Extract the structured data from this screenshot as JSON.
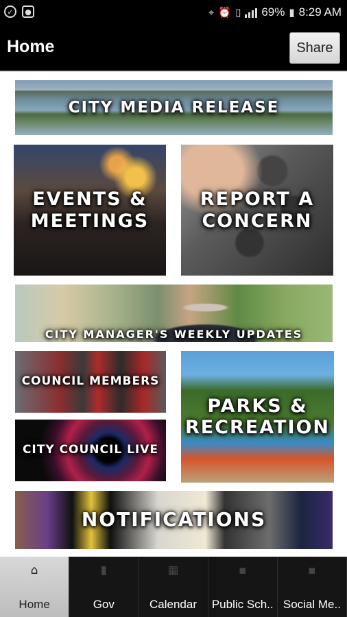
{
  "status_bar": {
    "battery": "69%",
    "time": "8:29 AM",
    "icons": [
      "check-circle-icon",
      "camera-icon",
      "location-icon",
      "alarm-icon",
      "vibrate-icon",
      "signal-icon",
      "battery-icon"
    ]
  },
  "header": {
    "title": "Home",
    "share_label": "Share"
  },
  "tiles": [
    {
      "label": "CITY MEDIA RELEASE"
    },
    {
      "label": "EVENTS &\nMEETINGS"
    },
    {
      "label": "REPORT A\nCONCERN"
    },
    {
      "label": "CITY MANAGER'S WEEKLY UPDATES"
    },
    {
      "label": "COUNCIL MEMBERS"
    },
    {
      "label": "CITY COUNCIL LIVE"
    },
    {
      "label": "PARKS &\nRECREATION"
    },
    {
      "label": "NOTIFICATIONS"
    }
  ],
  "bottom_nav": {
    "active": "Home",
    "items": [
      {
        "label": "Home",
        "icon": "home-icon"
      },
      {
        "label": "Gov",
        "icon": "book-icon"
      },
      {
        "label": "Calendar",
        "icon": "calendar-icon"
      },
      {
        "label": "Public Sch..",
        "icon": "school-icon"
      },
      {
        "label": "Social Me..",
        "icon": "social-icon"
      }
    ]
  }
}
